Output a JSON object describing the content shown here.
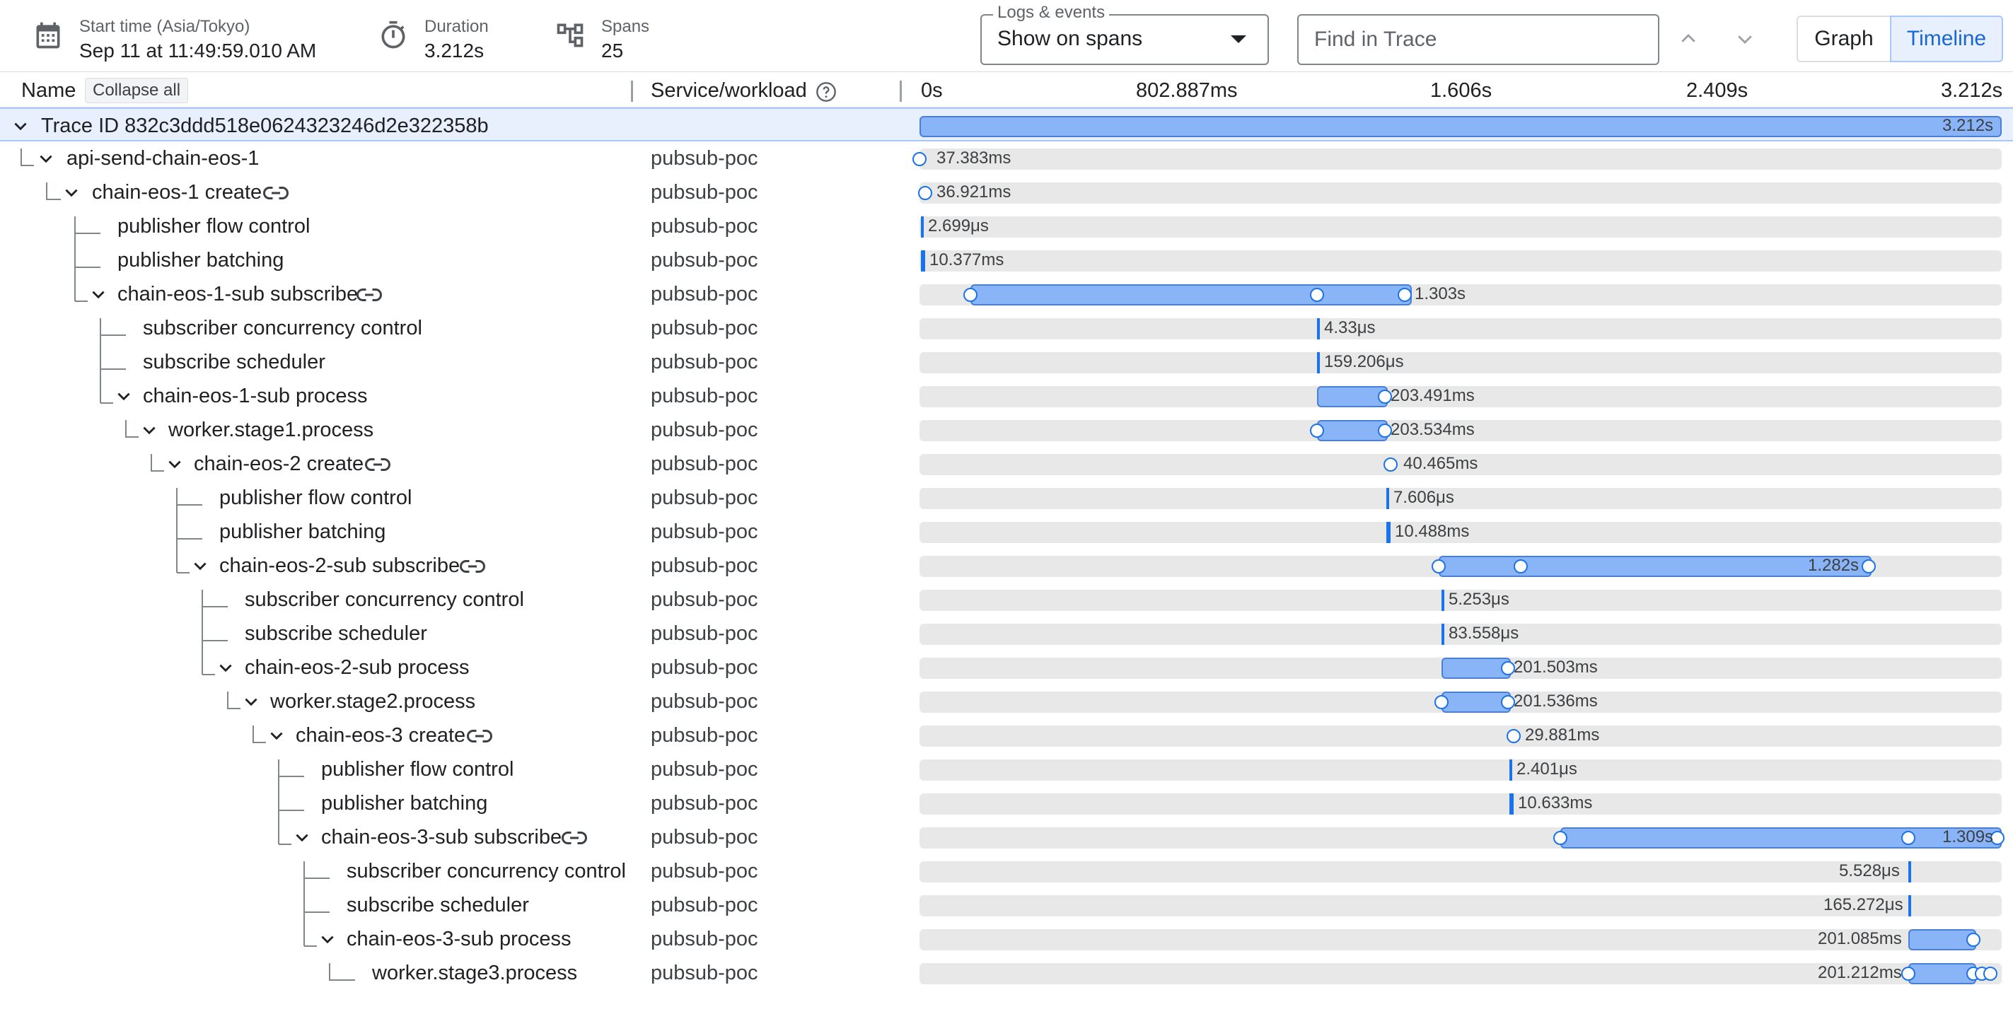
{
  "header": {
    "start_time_label": "Start time (Asia/Tokyo)",
    "start_time_value": "Sep 11 at 11:49:59.010 AM",
    "duration_label": "Duration",
    "duration_value": "3.212s",
    "spans_label": "Spans",
    "spans_value": "25",
    "logs_label": "Logs & events",
    "logs_value": "Show on spans",
    "find_placeholder": "Find in Trace",
    "view_graph": "Graph",
    "view_timeline": "Timeline"
  },
  "columns": {
    "name": "Name",
    "collapse_all": "Collapse all",
    "service": "Service/workload",
    "ticks": [
      "0s",
      "802.887ms",
      "1.606s",
      "2.409s",
      "3.212s"
    ]
  },
  "trace": {
    "label": "Trace ID 832c3ddd518e0624323246d2e322358b",
    "duration": "3.212s"
  },
  "spans": [
    {
      "name": "api-send-chain-eos-1",
      "service": "pubsub-poc",
      "duration": "37.383ms"
    },
    {
      "name": "chain-eos-1 create",
      "service": "pubsub-poc",
      "duration": "36.921ms"
    },
    {
      "name": "publisher flow control",
      "service": "pubsub-poc",
      "duration": "2.699μs"
    },
    {
      "name": "publisher batching",
      "service": "pubsub-poc",
      "duration": "10.377ms"
    },
    {
      "name": "chain-eos-1-sub subscribe",
      "service": "pubsub-poc",
      "duration": "1.303s"
    },
    {
      "name": "subscriber concurrency control",
      "service": "pubsub-poc",
      "duration": "4.33μs"
    },
    {
      "name": "subscribe scheduler",
      "service": "pubsub-poc",
      "duration": "159.206μs"
    },
    {
      "name": "chain-eos-1-sub process",
      "service": "pubsub-poc",
      "duration": "203.491ms"
    },
    {
      "name": "worker.stage1.process",
      "service": "pubsub-poc",
      "duration": "203.534ms"
    },
    {
      "name": "chain-eos-2 create",
      "service": "pubsub-poc",
      "duration": "40.465ms"
    },
    {
      "name": "publisher flow control",
      "service": "pubsub-poc",
      "duration": "7.606μs"
    },
    {
      "name": "publisher batching",
      "service": "pubsub-poc",
      "duration": "10.488ms"
    },
    {
      "name": "chain-eos-2-sub subscribe",
      "service": "pubsub-poc",
      "duration": "1.282s"
    },
    {
      "name": "subscriber concurrency control",
      "service": "pubsub-poc",
      "duration": "5.253μs"
    },
    {
      "name": "subscribe scheduler",
      "service": "pubsub-poc",
      "duration": "83.558μs"
    },
    {
      "name": "chain-eos-2-sub process",
      "service": "pubsub-poc",
      "duration": "201.503ms"
    },
    {
      "name": "worker.stage2.process",
      "service": "pubsub-poc",
      "duration": "201.536ms"
    },
    {
      "name": "chain-eos-3 create",
      "service": "pubsub-poc",
      "duration": "29.881ms"
    },
    {
      "name": "publisher flow control",
      "service": "pubsub-poc",
      "duration": "2.401μs"
    },
    {
      "name": "publisher batching",
      "service": "pubsub-poc",
      "duration": "10.633ms"
    },
    {
      "name": "chain-eos-3-sub subscribe",
      "service": "pubsub-poc",
      "duration": "1.309s"
    },
    {
      "name": "subscriber concurrency control",
      "service": "pubsub-poc",
      "duration": "5.528μs"
    },
    {
      "name": "subscribe scheduler",
      "service": "pubsub-poc",
      "duration": "165.272μs"
    },
    {
      "name": "chain-eos-3-sub process",
      "service": "pubsub-poc",
      "duration": "201.085ms"
    },
    {
      "name": "worker.stage3.process",
      "service": "pubsub-poc",
      "duration": "201.212ms"
    }
  ]
}
